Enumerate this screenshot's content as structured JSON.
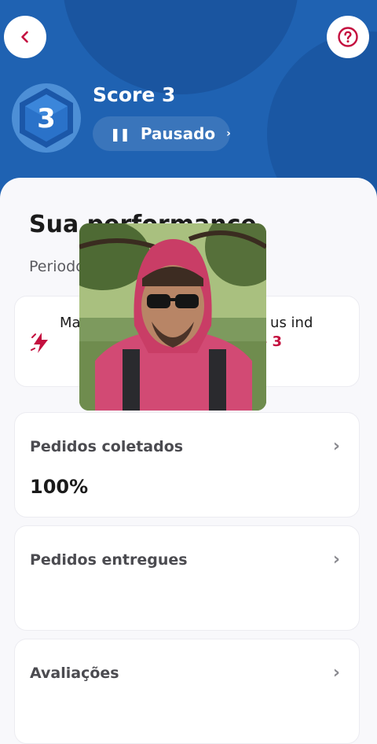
{
  "header": {
    "score_title": "Score 3",
    "badge_number": "3",
    "status_label": "Pausado",
    "back_icon": "chevron-left-icon",
    "help_icon": "question-circle-icon"
  },
  "performance": {
    "title": "Sua performance",
    "period": "Periodo"
  },
  "tip": {
    "text_start": "Ma",
    "text_middle": "us ind",
    "highlight": "no Score 3",
    "icon": "lightning-bolt-icon"
  },
  "metrics": [
    {
      "label": "Pedidos coletados",
      "value": "100%"
    },
    {
      "label": "Pedidos entregues",
      "value": ""
    },
    {
      "label": "Avaliações",
      "value": ""
    }
  ],
  "colors": {
    "header_blue": "#1f62b2",
    "accent_red": "#c4103f",
    "sheet_bg": "#f8f8fb"
  }
}
